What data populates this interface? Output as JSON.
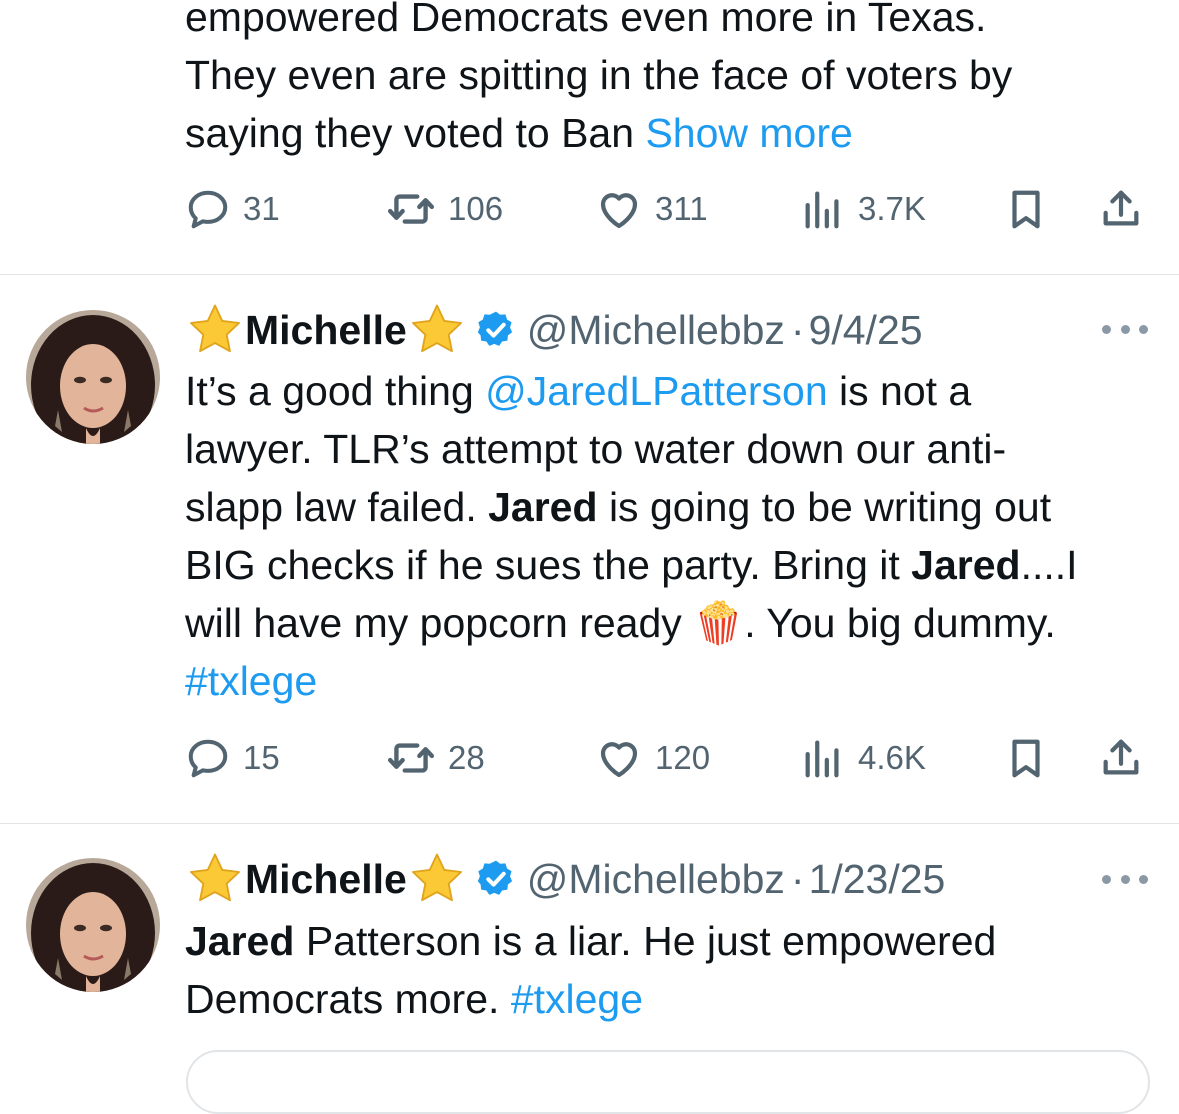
{
  "tweets": [
    {
      "body": {
        "lines": [
          "empowered Democrats even more in Texas.",
          "They even are spitting in the face of voters by",
          "saying they voted to Ban"
        ],
        "show_more": "Show more"
      },
      "actions": {
        "replies": "31",
        "reposts": "106",
        "likes": "311",
        "views": "3.7K"
      }
    },
    {
      "author": {
        "display_name": "Michelle",
        "handle": "@Michellebbz",
        "separator": "·",
        "date": "9/4/25",
        "verified": true
      },
      "body": {
        "t1": "It’s a good thing ",
        "mention": "@JaredLPatterson",
        "t2": " is not a",
        "t3": "lawyer. TLR’s attempt to water down our anti-",
        "t4": "slapp law failed. ",
        "b1": "Jared",
        "t5": " is going to be writing out",
        "t6": "BIG checks if he sues the party. Bring it ",
        "b2": "Jared",
        "t7": "....I",
        "t8": "will have my popcorn ready ",
        "emoji": "🍿",
        "t9": ". You big dummy.",
        "hashtag": "#txlege"
      },
      "actions": {
        "replies": "15",
        "reposts": "28",
        "likes": "120",
        "views": "4.6K"
      }
    },
    {
      "author": {
        "display_name": "Michelle",
        "handle": "@Michellebbz",
        "separator": "·",
        "date": "1/23/25",
        "verified": true
      },
      "body": {
        "b1": "Jared",
        "t1": " Patterson is a liar. He just empowered",
        "t2": "Democrats more. ",
        "hashtag": "#txlege"
      }
    }
  ],
  "icons": {
    "reply": "reply-bubble-icon",
    "repost": "repost-arrows-icon",
    "like": "heart-icon",
    "views": "bar-chart-icon",
    "bookmark": "bookmark-icon",
    "share": "share-upload-icon",
    "verified": "verified-badge-icon",
    "star": "star-emoji-icon",
    "more": "more-dots-icon"
  },
  "colors": {
    "link": "#1d9bf0",
    "secondary": "#536471",
    "text": "#0f1419",
    "divider": "#e1e5e8"
  }
}
